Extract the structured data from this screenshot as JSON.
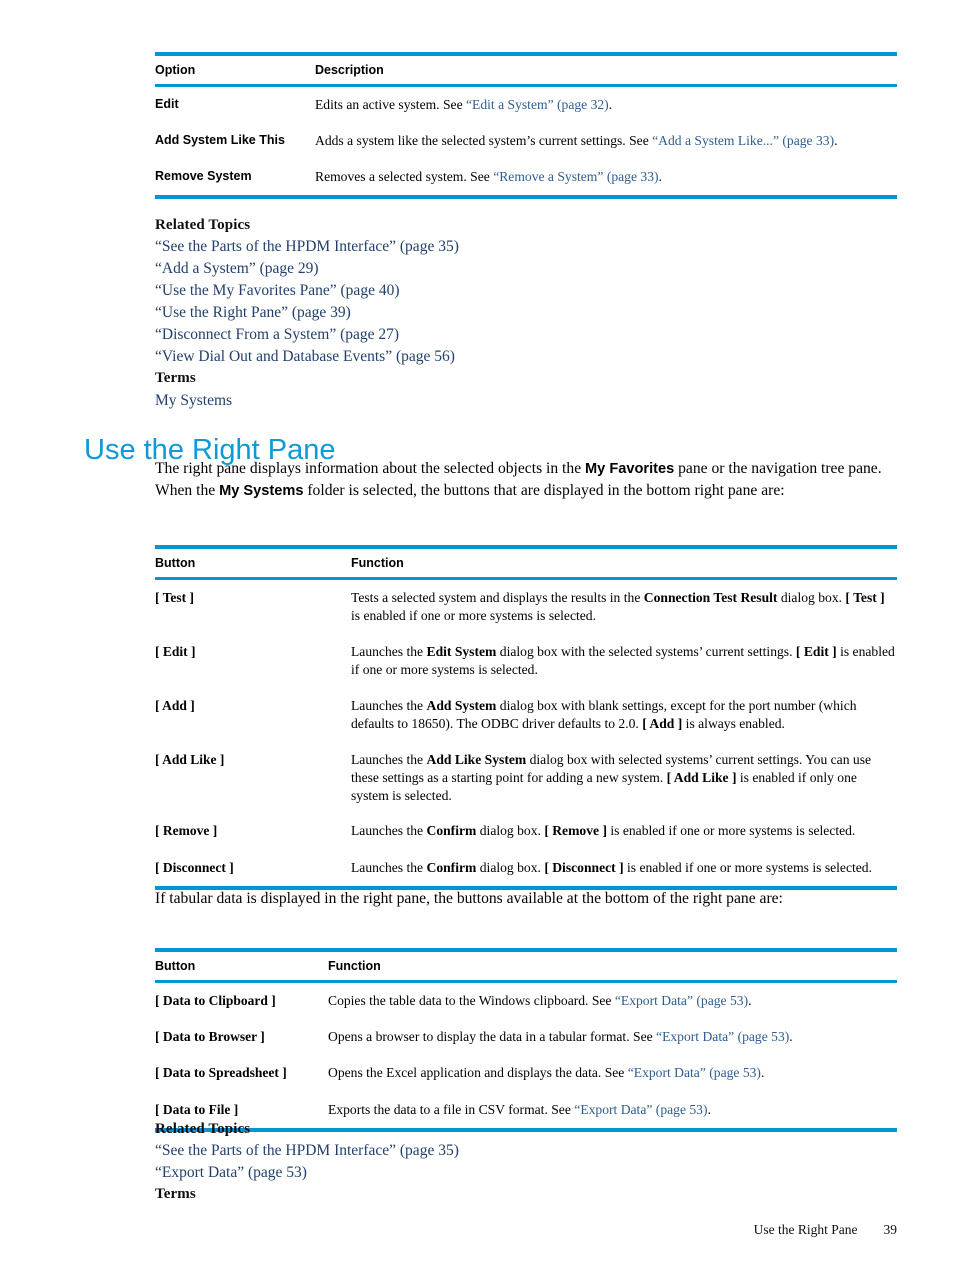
{
  "colors": {
    "rule": "#0096d6",
    "heading": "#0e9ad5",
    "link_in_table": "#2f5d8f",
    "link_related": "#23406d",
    "text": "#000000"
  },
  "table_options": {
    "headers": [
      "Option",
      "Description"
    ],
    "rows": [
      {
        "option": "Edit",
        "desc_pre": "Edits an active system. See ",
        "desc_link": "“Edit a System” (page 32)",
        "desc_post": "."
      },
      {
        "option": "Add System Like This",
        "desc_pre": "Adds a system like the selected system’s current settings. See ",
        "desc_link": "“Add a System Like...” (page 33)",
        "desc_post": "."
      },
      {
        "option": "Remove System",
        "desc_pre": "Removes a selected system. See ",
        "desc_link": "“Remove a System” (page 33)",
        "desc_post": "."
      }
    ]
  },
  "related_topics_1": {
    "heading": "Related Topics",
    "links": [
      "“See the Parts of the HPDM Interface” (page 35)",
      "“Add a System” (page 29)",
      "“Use the My Favorites Pane” (page 40)",
      "“Use the Right Pane” (page 39)",
      "“Disconnect From a System” (page 27)",
      "“View Dial Out and Database Events” (page 56)"
    ],
    "terms_heading": "Terms",
    "terms": [
      "My Systems"
    ]
  },
  "section": {
    "title": "Use the Right Pane",
    "intro_1": "The right pane displays information about the selected objects in the ",
    "intro_bold_1": "My Favorites",
    "intro_2": " pane or the navigation tree pane. When the ",
    "intro_bold_2": "My Systems",
    "intro_3": " folder is selected, the buttons that are displayed in the bottom right pane are:",
    "mid_paragraph": "If tabular data is displayed in the right pane, the buttons available at the bottom of the right pane are:"
  },
  "table_buttons": {
    "headers": [
      "Button",
      "Function"
    ],
    "rows": [
      {
        "button": "[ Test ]",
        "fn_parts": [
          {
            "t": "Tests a selected system and displays the results in the ",
            "b": false
          },
          {
            "t": "Connection Test Result",
            "b": true
          },
          {
            "t": " dialog box. ",
            "b": false
          },
          {
            "t": "[ Test ]",
            "b": true
          },
          {
            "t": " is enabled if one or more systems is selected.",
            "b": false
          }
        ]
      },
      {
        "button": "[ Edit ]",
        "fn_parts": [
          {
            "t": "Launches the ",
            "b": false
          },
          {
            "t": "Edit System",
            "b": true
          },
          {
            "t": " dialog box with the selected systems’ current settings. ",
            "b": false
          },
          {
            "t": "[ Edit ]",
            "b": true
          },
          {
            "t": " is enabled if one or more systems is selected.",
            "b": false
          }
        ]
      },
      {
        "button": "[ Add ]",
        "fn_parts": [
          {
            "t": "Launches the ",
            "b": false
          },
          {
            "t": "Add System",
            "b": true
          },
          {
            "t": " dialog box with blank settings, except for the port number (which defaults to 18650). The ODBC driver defaults to 2.0. ",
            "b": false
          },
          {
            "t": "[ Add ]",
            "b": true
          },
          {
            "t": " is always enabled.",
            "b": false
          }
        ]
      },
      {
        "button": "[ Add Like ]",
        "fn_parts": [
          {
            "t": "Launches the ",
            "b": false
          },
          {
            "t": "Add Like System",
            "b": true
          },
          {
            "t": " dialog box with selected systems’ current settings. You can use these settings as a starting point for adding a new system. ",
            "b": false
          },
          {
            "t": "[ Add Like ]",
            "b": true
          },
          {
            "t": " is enabled if only one system is selected.",
            "b": false
          }
        ]
      },
      {
        "button": "[ Remove ]",
        "fn_parts": [
          {
            "t": "Launches the ",
            "b": false
          },
          {
            "t": "Confirm",
            "b": true
          },
          {
            "t": " dialog box. ",
            "b": false
          },
          {
            "t": "[ Remove ]",
            "b": true
          },
          {
            "t": " is enabled if one or more systems is selected.",
            "b": false
          }
        ]
      },
      {
        "button": "[ Disconnect ]",
        "fn_parts": [
          {
            "t": "Launches the ",
            "b": false
          },
          {
            "t": "Confirm",
            "b": true
          },
          {
            "t": " dialog box. ",
            "b": false
          },
          {
            "t": "[ Disconnect ]",
            "b": true
          },
          {
            "t": " is enabled if one or more systems is selected.",
            "b": false
          }
        ]
      }
    ]
  },
  "table_export": {
    "headers": [
      "Button",
      "Function"
    ],
    "rows": [
      {
        "button": "[ Data to Clipboard ]",
        "fn_pre": "Copies the table data to the Windows clipboard. See ",
        "fn_link": "“Export Data” (page 53)",
        "fn_post": "."
      },
      {
        "button": "[ Data to Browser ]",
        "fn_pre": "Opens a browser to display the data in a tabular format. See ",
        "fn_link": "“Export Data” (page 53)",
        "fn_post": "."
      },
      {
        "button": "[ Data to Spreadsheet ]",
        "fn_pre": "Opens the Excel application and displays the data. See ",
        "fn_link": "“Export Data” (page 53)",
        "fn_post": "."
      },
      {
        "button": "[ Data to File ]",
        "fn_pre": "Exports the data to a file in CSV format. See ",
        "fn_link": "“Export Data” (page 53)",
        "fn_post": "."
      }
    ]
  },
  "related_topics_2": {
    "heading": "Related Topics",
    "links": [
      "“See the Parts of the HPDM Interface” (page 35)",
      "“Export Data” (page 53)"
    ],
    "terms_heading": "Terms"
  },
  "footer": {
    "section_label": "Use the Right Pane",
    "page_number": "39"
  }
}
